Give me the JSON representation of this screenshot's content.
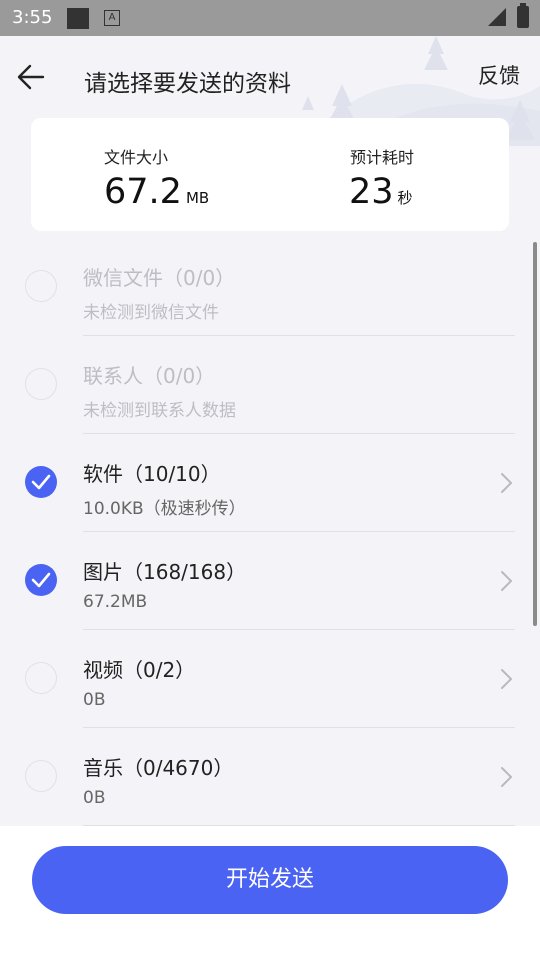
{
  "status_bar": {
    "time": "3:55",
    "notification_letter": "A"
  },
  "header": {
    "title": "请选择要发送的资料",
    "feedback_label": "反馈"
  },
  "summary": {
    "size_label": "文件大小",
    "size_value": "67.2",
    "size_unit": "MB",
    "time_label": "预计耗时",
    "time_value": "23",
    "time_unit": "秒"
  },
  "items": [
    {
      "name": "微信文件",
      "count": "（0/0）",
      "sub": "未检测到微信文件",
      "checked": false,
      "disabled": true
    },
    {
      "name": "联系人",
      "count": "（0/0）",
      "sub": "未检测到联系人数据",
      "checked": false,
      "disabled": true
    },
    {
      "name": "软件",
      "count": "（10/10）",
      "sub": "10.0KB（极速秒传）",
      "checked": true,
      "disabled": false
    },
    {
      "name": "图片",
      "count": "（168/168）",
      "sub": "67.2MB",
      "checked": true,
      "disabled": false
    },
    {
      "name": "视频",
      "count": "（0/2）",
      "sub": "0B",
      "checked": false,
      "disabled": false
    },
    {
      "name": "音乐",
      "count": "（0/4670）",
      "sub": "0B",
      "checked": false,
      "disabled": false
    }
  ],
  "footer": {
    "send_label": "开始发送"
  },
  "colors": {
    "accent": "#4a63f3",
    "background": "#f4f4f8"
  }
}
